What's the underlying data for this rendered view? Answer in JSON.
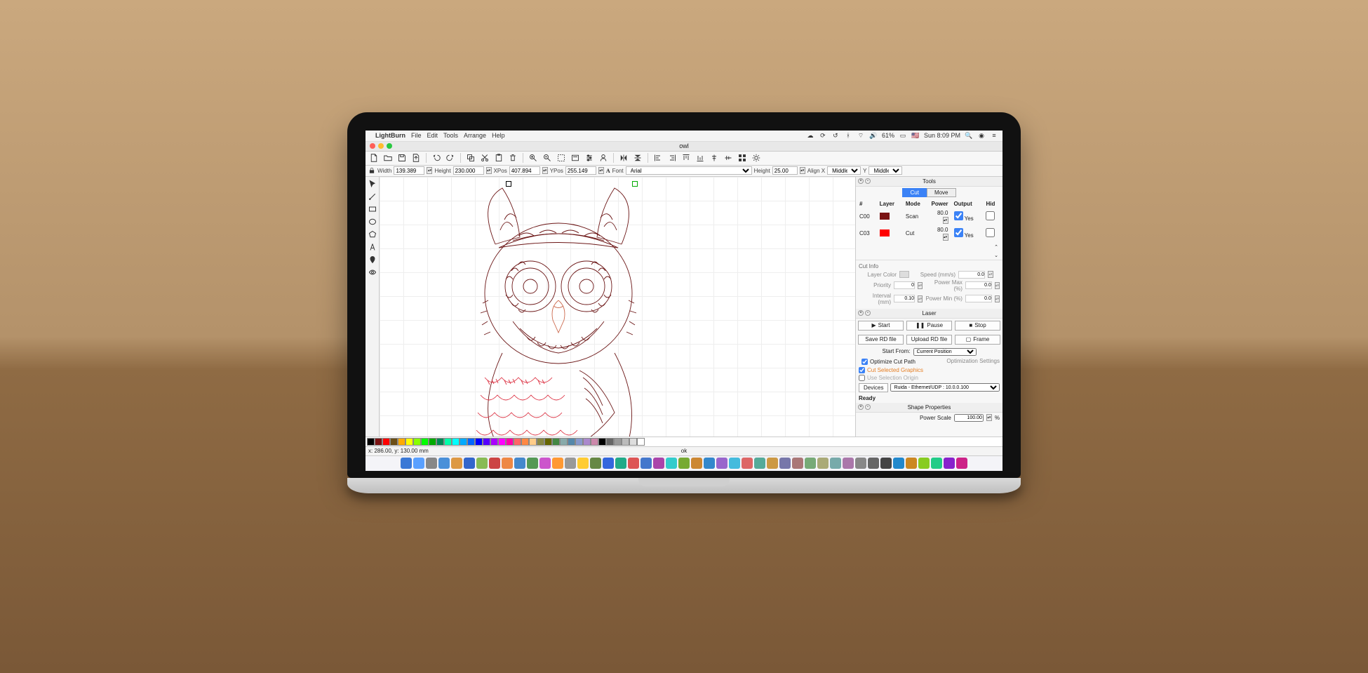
{
  "menubar": {
    "app": "LightBurn",
    "items": [
      "File",
      "Edit",
      "Tools",
      "Arrange",
      "Help"
    ],
    "status": {
      "battery": "61%",
      "time": "Sun 8:09 PM"
    }
  },
  "window": {
    "title": "owl"
  },
  "properties": {
    "width_label": "Width",
    "width": "139.389",
    "height_label": "Height",
    "height": "230.000",
    "xpos_label": "XPos",
    "xpos": "407.894",
    "ypos_label": "YPos",
    "ypos": "255.149",
    "font_label": "Font",
    "font": "Arial",
    "text_height_label": "Height",
    "text_height": "25.00",
    "alignx_label": "Align X",
    "alignx": "Middle",
    "aligny_label": "Y",
    "aligny": "Middle"
  },
  "tools_panel": {
    "title": "Tools",
    "tabs": {
      "cut": "Cut",
      "move": "Move"
    }
  },
  "layers": {
    "headers": {
      "num": "#",
      "layer": "Layer",
      "mode": "Mode",
      "power": "Power",
      "output": "Output",
      "hide": "Hid"
    },
    "rows": [
      {
        "id": "C00",
        "color": "#7a1313",
        "mode": "Scan",
        "power": "80.0",
        "output": true,
        "output_text": "Yes"
      },
      {
        "id": "C03",
        "color": "#ff0000",
        "mode": "Cut",
        "power": "80.0",
        "output": true,
        "output_text": "Yes"
      }
    ]
  },
  "cutinfo": {
    "title": "Cut Info",
    "layer_color": "Layer Color",
    "speed": "Speed  (mm/s)",
    "speed_val": "0.0",
    "priority": "Priority",
    "priority_val": "0",
    "power_max": "Power Max (%)",
    "power_max_val": "0.0",
    "interval": "Interval (mm)",
    "interval_val": "0.10",
    "power_min": "Power Min (%)",
    "power_min_val": "0.0"
  },
  "laser": {
    "title": "Laser",
    "start": "Start",
    "pause": "Pause",
    "stop": "Stop",
    "save_rd": "Save RD file",
    "upload_rd": "Upload RD file",
    "frame": "Frame",
    "start_from_label": "Start From:",
    "start_from": "Current Position",
    "opt_cut_path": "Optimize Cut Path",
    "opt_settings": "Optimization Settings",
    "cut_selected": "Cut Selected Graphics",
    "use_sel_origin": "Use Selection Origin",
    "devices": "Devices",
    "device": "Ruida - Ethernet/UDP : 10.0.0.100",
    "ready": "Ready"
  },
  "shape": {
    "title": "Shape Properties",
    "power_scale_label": "Power Scale",
    "power_scale": "100.00",
    "unit": "%"
  },
  "palette": [
    "#000000",
    "#7a1313",
    "#ff0000",
    "#6b4e16",
    "#ffaa00",
    "#ffff00",
    "#88ff00",
    "#00ff00",
    "#00aa00",
    "#008855",
    "#00ffaa",
    "#00ffff",
    "#00aaff",
    "#0066ff",
    "#0000ff",
    "#5500ff",
    "#aa00ff",
    "#ff00ff",
    "#ff00aa",
    "#ff6666",
    "#ff8844",
    "#ffcc88",
    "#888844",
    "#666600",
    "#448844",
    "#88aaaa",
    "#5588aa",
    "#8899cc",
    "#aa88cc",
    "#cc88aa",
    "#000000",
    "#666666",
    "#999999",
    "#bbbbbb",
    "#dddddd",
    "#ffffff"
  ],
  "statusbar": {
    "coords": "x: 286.00, y: 130.00 mm",
    "msg": "ok"
  }
}
